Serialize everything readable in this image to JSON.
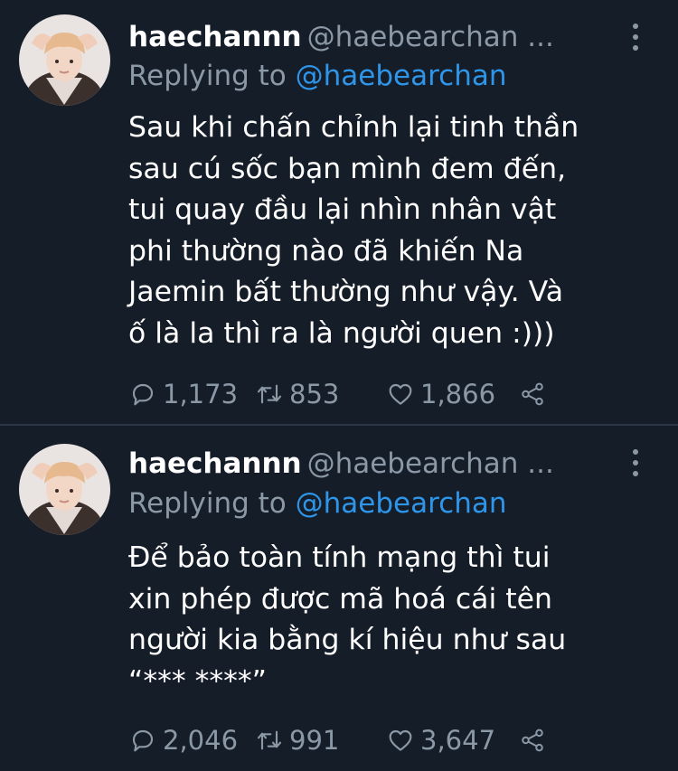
{
  "colors": {
    "background": "#151d29",
    "text": "#ffffff",
    "secondary": "#8b98a5",
    "link": "#2f95e8",
    "divider": "#2a3644"
  },
  "tweets": [
    {
      "display_name": "haechannn",
      "handle": "@haebearchan ...",
      "replying_prefix": "Replying to",
      "replying_to": "@haebearchan",
      "text": "Sau khi chấn chỉnh lại tinh thần\nsau cú sốc bạn mình đem đến,\ntui quay đầu lại nhìn nhân vật\nphi thường nào đã khiến Na\nJaemin bất thường như vậy. Và\nố là la thì ra là người quen :)))",
      "replies": "1,173",
      "retweets": "853",
      "likes": "1,866",
      "icons": [
        "avatar-image",
        "more-vertical-icon",
        "reply-icon",
        "retweet-icon",
        "like-icon",
        "share-icon"
      ]
    },
    {
      "display_name": "haechannn",
      "handle": "@haebearchan ...",
      "replying_prefix": "Replying to",
      "replying_to": "@haebearchan",
      "text": "Để bảo toàn tính mạng thì tui\nxin phép được mã hoá cái tên\nngười kia bằng kí hiệu như sau\n“*** ****”",
      "replies": "2,046",
      "retweets": "991",
      "likes": "3,647",
      "icons": [
        "avatar-image",
        "more-vertical-icon",
        "reply-icon",
        "retweet-icon",
        "like-icon",
        "share-icon"
      ]
    }
  ]
}
